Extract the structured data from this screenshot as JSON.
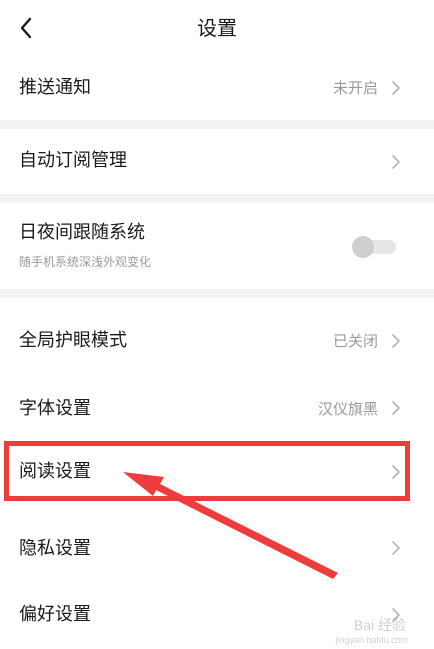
{
  "header": {
    "title": "设置"
  },
  "rows": {
    "push": {
      "label": "推送通知",
      "value": "未开启"
    },
    "subscribe": {
      "label": "自动订阅管理"
    },
    "night": {
      "label": "日夜间跟随系统",
      "sub": "随手机系统深浅外观变化",
      "toggle_on": false
    },
    "eye": {
      "label": "全局护眼模式",
      "value": "已关闭"
    },
    "font": {
      "label": "字体设置",
      "value": "汉仪旗黑"
    },
    "read": {
      "label": "阅读设置"
    },
    "privacy": {
      "label": "隐私设置"
    },
    "pref": {
      "label": "偏好设置"
    }
  },
  "watermark": {
    "brand": "Bai 经验",
    "url": "jingyan.baidu.com"
  },
  "colors": {
    "highlight": "#ee3b3b",
    "gap_bg": "#f3f3f3",
    "muted_text": "#9a9a9a"
  },
  "icons": {
    "back": "back-arrow-icon",
    "chevron": "chevron-right-icon"
  }
}
